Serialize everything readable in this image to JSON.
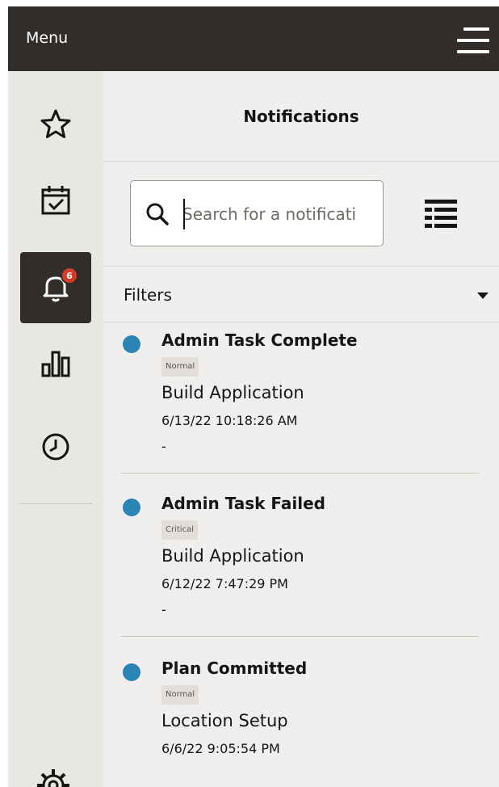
{
  "header": {
    "title": "Menu",
    "menu_icon": "hamburger-icon"
  },
  "sidebar": {
    "items": [
      {
        "name": "favorites",
        "icon": "star-icon"
      },
      {
        "name": "tasks",
        "icon": "calendar-check-icon"
      },
      {
        "name": "notifications",
        "icon": "bell-icon",
        "badge": "6",
        "active": true
      },
      {
        "name": "reports",
        "icon": "bar-chart-icon"
      },
      {
        "name": "recent",
        "icon": "clock-icon"
      }
    ],
    "bottom_icon": "gear-icon"
  },
  "panel": {
    "title": "Notifications",
    "search": {
      "placeholder": "Search for a notificati",
      "icon": "search-icon"
    },
    "view_toggle_icon": "list-view-icon",
    "filters": {
      "label": "Filters",
      "icon": "caret-down-icon"
    }
  },
  "notifications": [
    {
      "title": "Admin Task Complete",
      "priority": "Normal",
      "subject": "Build Application",
      "timestamp": "6/13/22 10:18:26 AM",
      "extra": "-"
    },
    {
      "title": "Admin Task Failed",
      "priority": "Critical",
      "subject": "Build Application",
      "timestamp": "6/12/22 7:47:29 PM",
      "extra": "-"
    },
    {
      "title": "Plan Committed",
      "priority": "Normal",
      "subject": "Location Setup",
      "timestamp": "6/6/22 9:05:54 PM"
    }
  ],
  "colors": {
    "header_bg": "#312d2a",
    "sidebar_bg": "#e9e7e3",
    "panel_bg": "#f1efed",
    "unread_dot": "#2a85b5",
    "badge": "#d63b25"
  }
}
